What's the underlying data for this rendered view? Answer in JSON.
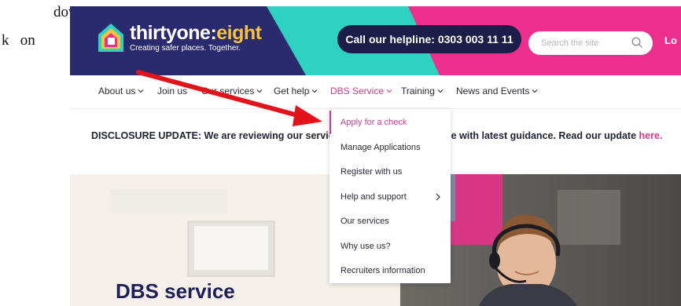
{
  "doc": {
    "line1": "down",
    "line2": "k   on"
  },
  "header": {
    "logo_name_prefix": "thirtyone:",
    "logo_name_accent": "eight",
    "logo_tagline": "Creating safer places. Together.",
    "helpline_label": "Call our helpline: 0303 003 11 11",
    "search_placeholder": "Search the site",
    "login_label": "Lo"
  },
  "nav": {
    "items": [
      {
        "label": "About us",
        "has_chevron": true
      },
      {
        "label": "Join us",
        "has_chevron": false
      },
      {
        "label": "Our services",
        "has_chevron": true
      },
      {
        "label": "Get help",
        "has_chevron": true
      },
      {
        "label": "DBS Service",
        "has_chevron": true,
        "active": true
      },
      {
        "label": "Training",
        "has_chevron": true
      },
      {
        "label": "News and Events",
        "has_chevron": true
      }
    ]
  },
  "disclosure": {
    "left_text": "DISCLOSURE UPDATE: We are reviewing our service",
    "right_text": "line with latest guidance. Read our update",
    "link_text": "here."
  },
  "dropdown": {
    "items": [
      {
        "label": "Apply for a check",
        "active": true
      },
      {
        "label": "Manage Applications"
      },
      {
        "label": "Register with us"
      },
      {
        "label": "Help and support",
        "has_submenu": true
      },
      {
        "label": "Our services"
      },
      {
        "label": "Why use us?"
      },
      {
        "label": "Recruiters information"
      }
    ]
  },
  "hero": {
    "title": "DBS service"
  },
  "colors": {
    "brand_navy": "#2a2a6e",
    "brand_teal": "#2fd1c0",
    "brand_pink": "#ec2f8c",
    "accent_pink": "#d43a8a",
    "logo_yellow": "#f4c23b",
    "annotation_red": "#e3131b"
  }
}
